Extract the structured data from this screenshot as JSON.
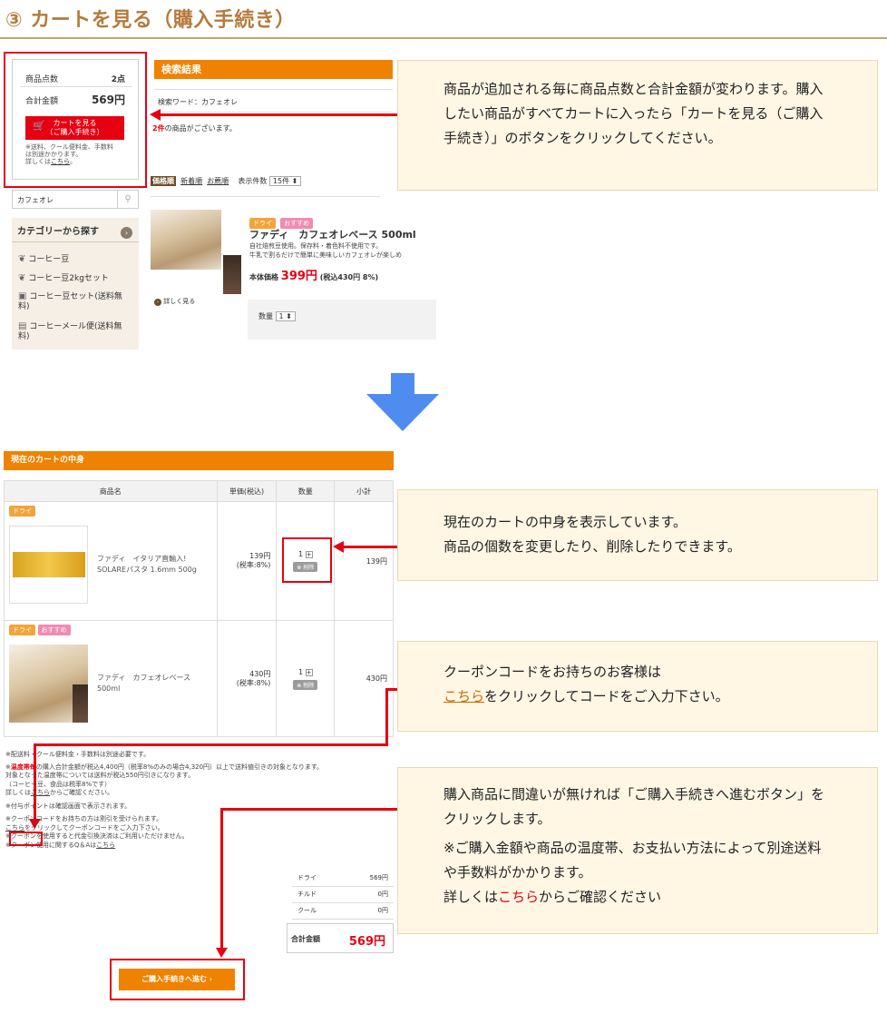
{
  "header": {
    "title": "③ カートを見る（購入手続き）"
  },
  "cart_summary": {
    "items_label": "商品点数",
    "items_value": "2点",
    "total_label": "合計金額",
    "total_value": "569円",
    "button_line1": "カートを見る",
    "button_line2": "（ご購入手続き）",
    "note_line1": "※送料、クール便料金、手数料",
    "note_line2": "は別途かかります。",
    "note_line3_prefix": "詳しくは",
    "note_link": "こちら",
    "note_line3_suffix": "。"
  },
  "search": {
    "value": "カフェオレ",
    "icon": "search-icon"
  },
  "category": {
    "heading": "カテゴリーから探す",
    "items": [
      {
        "label": "コーヒー豆",
        "icon": "coffee-bean-icon"
      },
      {
        "label": "コーヒー豆2kgセット",
        "icon": "coffee-bean-icon"
      },
      {
        "label": "コーヒー豆セット(送料無料)",
        "icon": "gift-box-icon"
      },
      {
        "label": "コーヒーメール便(送料無料)",
        "icon": "mail-icon"
      }
    ]
  },
  "results": {
    "heading": "検索結果",
    "keyword_label": "検索ワード：カフェオレ",
    "count_num": "2件",
    "count_suffix": "の商品がございます。",
    "sort": {
      "active": "価格順",
      "newest": "新着順",
      "recommended": "お薦順",
      "per_page_label": "表示件数",
      "per_page_value": "15件 ⬍"
    },
    "product": {
      "tag_dry": "ドライ",
      "tag_rec": "おすすめ",
      "name": "ファディ　カフェオレベース 500ml",
      "desc1": "自社焙煎豆使用。保存料・着色料不使用です。",
      "desc2": "牛乳で割るだけで簡単に美味しいカフェオレが楽しめ",
      "price_label": "本体価格",
      "price": "399円",
      "tax": "(税込430円 8%)",
      "detail": "詳しく見る",
      "qty_label": "数量",
      "qty_value": "1 ⬍"
    }
  },
  "callouts": {
    "c1": "商品が追加される毎に商品点数と合計金額が変わります。購入したい商品がすべてカートに入ったら「カートを見る（ご購入手続き）」のボタンをクリックしてください。",
    "c2_line1": "現在のカートの中身を表示しています。",
    "c2_line2": "商品の個数を変更したり、削除したりできます。",
    "c3_line1": "クーポンコードをお持ちのお客様は",
    "c3_link": "こちら",
    "c3_suffix": "をクリックしてコードをご入力下さい。",
    "c4_line1": "購入商品に間違いが無ければ「ご購入手続きへ進むボタン」をクリックします。",
    "c4_line2": "※ご購入金額や商品の温度帯、お支払い方法によって別途送料や手数料がかかります。",
    "c4_line3_prefix": "詳しくは",
    "c4_link": "こちら",
    "c4_line3_suffix": "からご確認ください"
  },
  "cart": {
    "heading": "現在のカートの中身",
    "columns": [
      "商品名",
      "単価(税込)",
      "数量",
      "小計"
    ],
    "rows": [
      {
        "tags": [
          "ドライ"
        ],
        "name1": "ファディ　イタリア直輸入!",
        "name2": "SOLAREパスタ 1.6mm 500g",
        "price1": "139円",
        "price2": "(税率:8%)",
        "qty": "1",
        "plus": "+",
        "delete": "削除",
        "subtotal": "139円"
      },
      {
        "tags": [
          "ドライ",
          "おすすめ"
        ],
        "name1": "ファディ　カフェオレベース",
        "name2": "500ml",
        "price1": "430円",
        "price2": "(税率:8%)",
        "qty": "1",
        "plus": "+",
        "delete": "削除",
        "subtotal": "430円"
      }
    ]
  },
  "notes": {
    "n1": "※配送料・クール便料金・手数料は別途必要です。",
    "n2_prefix": "※",
    "n2_red": "温度帯毎",
    "n2_rest": "の購入合計金額が税込4,400円（税率8%のみの場合4,320円）以上で送料値引きの対象となります。",
    "n3": "対象となった温度帯については送料が税込550円引きになります。",
    "n4": "（コーヒー豆、食品は税率8%です）",
    "n5_prefix": "詳しくは",
    "n5_link": "こちら",
    "n5_suffix": "からご確認ください。",
    "n6": "※付与ポイントは確認画面で表示されます。",
    "n7": "※クーポンコードをお持ちの方は割引を受けられます。",
    "n8_link": "こちら",
    "n8_suffix": "をクリックしてクーポンコードをご入力下さい。",
    "n9": "※クーポンを使用すると代金引換決済はご利用いただけません。",
    "n10_prefix": "※クーポン使用に関するQ＆Aは",
    "n10_link": "こちら"
  },
  "fees": [
    {
      "label": "ドライ",
      "value": "569円"
    },
    {
      "label": "チルド",
      "value": "0円"
    },
    {
      "label": "クール",
      "value": "0円"
    }
  ],
  "total": {
    "label": "合計金額",
    "value": "569円"
  },
  "checkout": {
    "label": "ご購入手続きへ進む ›"
  },
  "colors": {
    "accent": "#ef8200",
    "alert": "#e60012",
    "arrow": "#4f8cf0",
    "callout_bg": "#fff6e4"
  }
}
